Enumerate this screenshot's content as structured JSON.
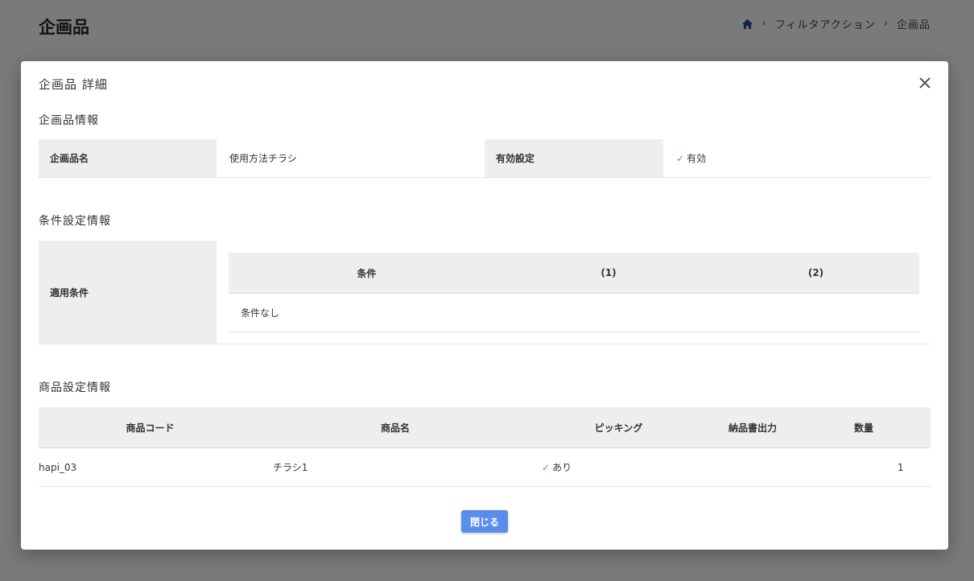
{
  "page": {
    "title": "企画品",
    "breadcrumb": [
      "フィルタアクション",
      "企画品"
    ]
  },
  "modal": {
    "title": "企画品 詳細",
    "close_icon": "close-icon",
    "sections": {
      "info_title": "企画品情報",
      "condition_title": "条件設定情報",
      "product_title": "商品設定情報"
    },
    "info": {
      "name_label": "企画品名",
      "name_value": "使用方法チラシ",
      "enabled_label": "有効設定",
      "enabled_value": "有効"
    },
    "condition": {
      "label": "適用条件",
      "headers": [
        "条件",
        "(1)",
        "(2)"
      ],
      "rows": [
        [
          "条件なし",
          "",
          ""
        ]
      ]
    },
    "products": {
      "headers": [
        "商品コード",
        "商品名",
        "ピッキング",
        "納品書出力",
        "数量"
      ],
      "rows": [
        {
          "code": "hapi_03",
          "name": "チラシ1",
          "picking": "あり",
          "invoice": "",
          "qty": "1"
        }
      ]
    },
    "footer": {
      "close_label": "閉じる"
    }
  },
  "colors": {
    "accent": "#5b8def",
    "check": "#4caf50",
    "header_bg": "#edeef0"
  }
}
